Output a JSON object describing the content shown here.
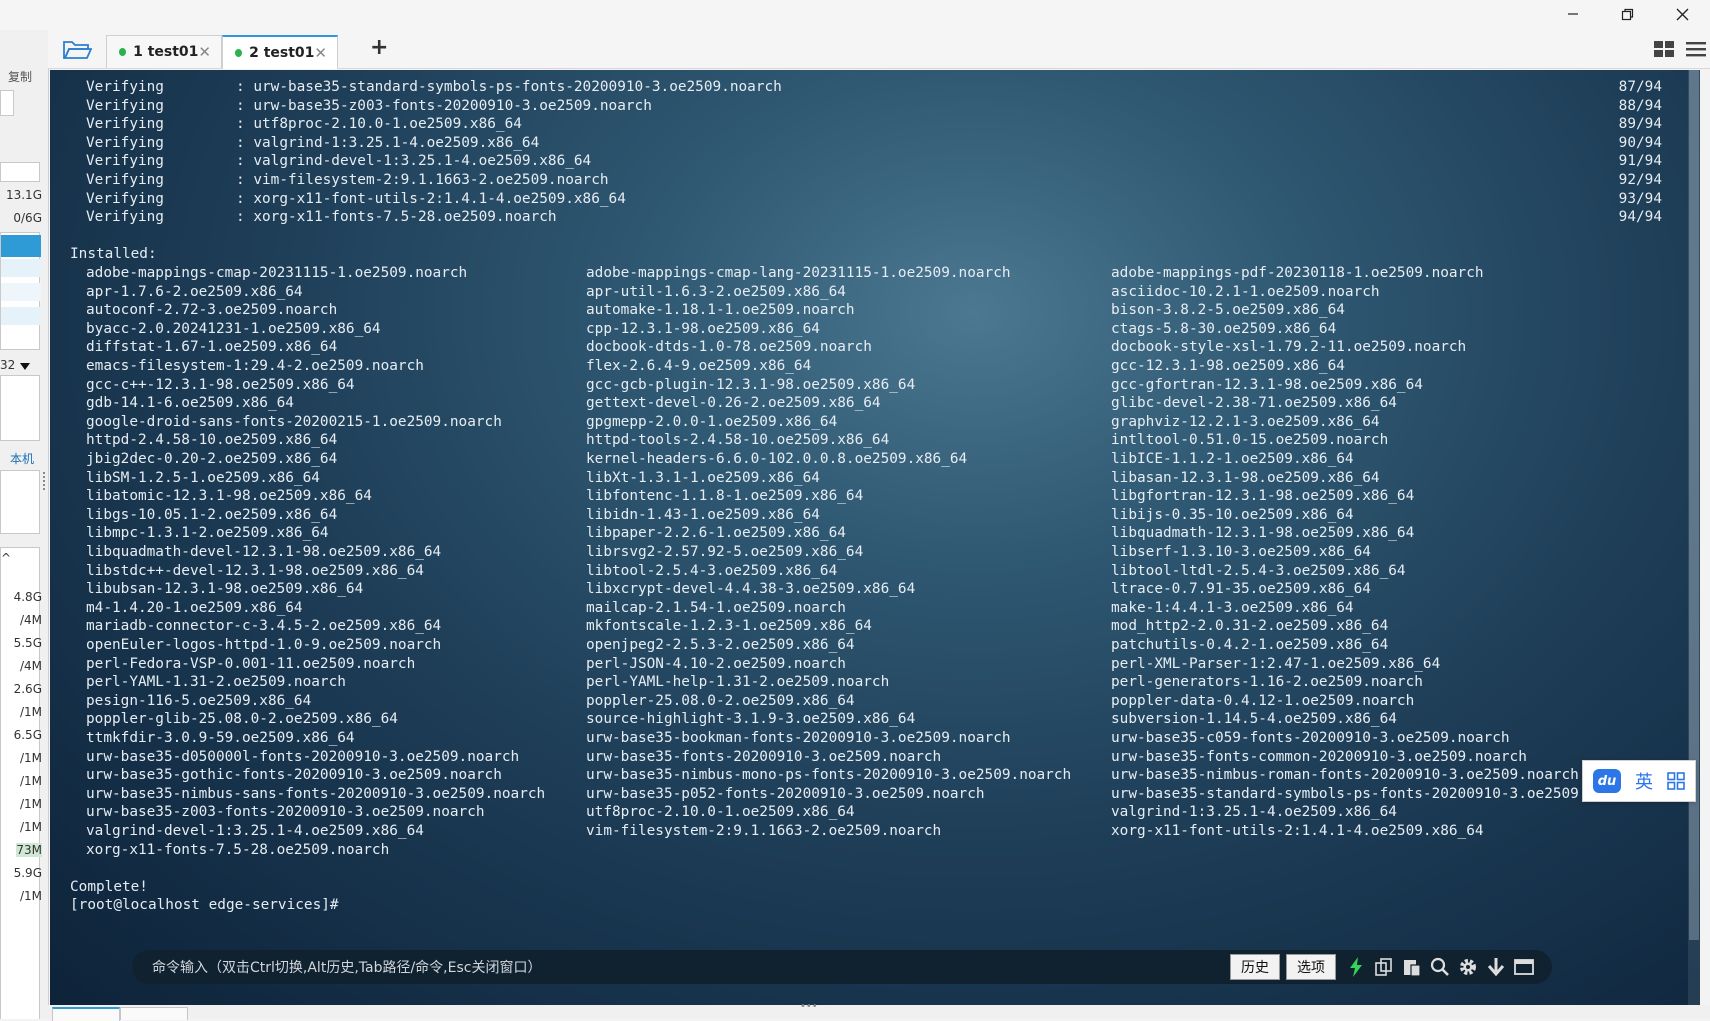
{
  "window": {
    "minimize_icon": "minimize-icon",
    "maximize_icon": "restore-icon",
    "close_icon": "close-icon"
  },
  "sidebar": {
    "copy_label": "复制",
    "local_label": "本机",
    "dropdown_value": "32",
    "disk_values": [
      "13.1G",
      "0/6G"
    ],
    "sizes": [
      "4.8G",
      "/4M",
      "5.5G",
      "/4M",
      "2.6G",
      "/1M",
      "6.5G",
      "/1M",
      "/1M",
      "/1M",
      "/1M",
      "73M",
      "5.9G",
      "/1M"
    ]
  },
  "tabs": [
    {
      "index": "1",
      "label": "test01",
      "active": false
    },
    {
      "index": "2",
      "label": "test01",
      "active": true
    }
  ],
  "tabbar": {
    "add_icon": "plus-icon",
    "folder_icon": "folder-open-icon",
    "layout_icon": "grid-layout-icon",
    "menu_icon": "hamburger-menu-icon"
  },
  "terminal": {
    "verifying": [
      {
        "label": "Verifying",
        "pkg": ": urw-base35-standard-symbols-ps-fonts-20200910-3.oe2509.noarch",
        "progress": "87/94"
      },
      {
        "label": "Verifying",
        "pkg": ": urw-base35-z003-fonts-20200910-3.oe2509.noarch",
        "progress": "88/94"
      },
      {
        "label": "Verifying",
        "pkg": ": utf8proc-2.10.0-1.oe2509.x86_64",
        "progress": "89/94"
      },
      {
        "label": "Verifying",
        "pkg": ": valgrind-1:3.25.1-4.oe2509.x86_64",
        "progress": "90/94"
      },
      {
        "label": "Verifying",
        "pkg": ": valgrind-devel-1:3.25.1-4.oe2509.x86_64",
        "progress": "91/94"
      },
      {
        "label": "Verifying",
        "pkg": ": vim-filesystem-2:9.1.1663-2.oe2509.noarch",
        "progress": "92/94"
      },
      {
        "label": "Verifying",
        "pkg": ": xorg-x11-font-utils-2:1.4.1-4.oe2509.x86_64",
        "progress": "93/94"
      },
      {
        "label": "Verifying",
        "pkg": ": xorg-x11-fonts-7.5-28.oe2509.noarch",
        "progress": "94/94"
      }
    ],
    "installed_header": "Installed:",
    "installed": [
      [
        "adobe-mappings-cmap-20231115-1.oe2509.noarch",
        "adobe-mappings-cmap-lang-20231115-1.oe2509.noarch",
        "adobe-mappings-pdf-20230118-1.oe2509.noarch"
      ],
      [
        "apr-1.7.6-2.oe2509.x86_64",
        "apr-util-1.6.3-2.oe2509.x86_64",
        "asciidoc-10.2.1-1.oe2509.noarch"
      ],
      [
        "autoconf-2.72-3.oe2509.noarch",
        "automake-1.18.1-1.oe2509.noarch",
        "bison-3.8.2-5.oe2509.x86_64"
      ],
      [
        "byacc-2.0.20241231-1.oe2509.x86_64",
        "cpp-12.3.1-98.oe2509.x86_64",
        "ctags-5.8-30.oe2509.x86_64"
      ],
      [
        "diffstat-1.67-1.oe2509.x86_64",
        "docbook-dtds-1.0-78.oe2509.noarch",
        "docbook-style-xsl-1.79.2-11.oe2509.noarch"
      ],
      [
        "emacs-filesystem-1:29.4-2.oe2509.noarch",
        "flex-2.6.4-9.oe2509.x86_64",
        "gcc-12.3.1-98.oe2509.x86_64"
      ],
      [
        "gcc-c++-12.3.1-98.oe2509.x86_64",
        "gcc-gcb-plugin-12.3.1-98.oe2509.x86_64",
        "gcc-gfortran-12.3.1-98.oe2509.x86_64"
      ],
      [
        "gdb-14.1-6.oe2509.x86_64",
        "gettext-devel-0.26-2.oe2509.x86_64",
        "glibc-devel-2.38-71.oe2509.x86_64"
      ],
      [
        "google-droid-sans-fonts-20200215-1.oe2509.noarch",
        "gpgmepp-2.0.0-1.oe2509.x86_64",
        "graphviz-12.2.1-3.oe2509.x86_64"
      ],
      [
        "httpd-2.4.58-10.oe2509.x86_64",
        "httpd-tools-2.4.58-10.oe2509.x86_64",
        "intltool-0.51.0-15.oe2509.noarch"
      ],
      [
        "jbig2dec-0.20-2.oe2509.x86_64",
        "kernel-headers-6.6.0-102.0.0.8.oe2509.x86_64",
        "libICE-1.1.2-1.oe2509.x86_64"
      ],
      [
        "libSM-1.2.5-1.oe2509.x86_64",
        "libXt-1.3.1-1.oe2509.x86_64",
        "libasan-12.3.1-98.oe2509.x86_64"
      ],
      [
        "libatomic-12.3.1-98.oe2509.x86_64",
        "libfontenc-1.1.8-1.oe2509.x86_64",
        "libgfortran-12.3.1-98.oe2509.x86_64"
      ],
      [
        "libgs-10.05.1-2.oe2509.x86_64",
        "libidn-1.43-1.oe2509.x86_64",
        "libijs-0.35-10.oe2509.x86_64"
      ],
      [
        "libmpc-1.3.1-2.oe2509.x86_64",
        "libpaper-2.2.6-1.oe2509.x86_64",
        "libquadmath-12.3.1-98.oe2509.x86_64"
      ],
      [
        "libquadmath-devel-12.3.1-98.oe2509.x86_64",
        "librsvg2-2.57.92-5.oe2509.x86_64",
        "libserf-1.3.10-3.oe2509.x86_64"
      ],
      [
        "libstdc++-devel-12.3.1-98.oe2509.x86_64",
        "libtool-2.5.4-3.oe2509.x86_64",
        "libtool-ltdl-2.5.4-3.oe2509.x86_64"
      ],
      [
        "libubsan-12.3.1-98.oe2509.x86_64",
        "libxcrypt-devel-4.4.38-3.oe2509.x86_64",
        "ltrace-0.7.91-35.oe2509.x86_64"
      ],
      [
        "m4-1.4.20-1.oe2509.x86_64",
        "mailcap-2.1.54-1.oe2509.noarch",
        "make-1:4.4.1-3.oe2509.x86_64"
      ],
      [
        "mariadb-connector-c-3.4.5-2.oe2509.x86_64",
        "mkfontscale-1.2.3-1.oe2509.x86_64",
        "mod_http2-2.0.31-2.oe2509.x86_64"
      ],
      [
        "openEuler-logos-httpd-1.0-9.oe2509.noarch",
        "openjpeg2-2.5.3-2.oe2509.x86_64",
        "patchutils-0.4.2-1.oe2509.x86_64"
      ],
      [
        "perl-Fedora-VSP-0.001-11.oe2509.noarch",
        "perl-JSON-4.10-2.oe2509.noarch",
        "perl-XML-Parser-1:2.47-1.oe2509.x86_64"
      ],
      [
        "perl-YAML-1.31-2.oe2509.noarch",
        "perl-YAML-help-1.31-2.oe2509.noarch",
        "perl-generators-1.16-2.oe2509.noarch"
      ],
      [
        "pesign-116-5.oe2509.x86_64",
        "poppler-25.08.0-2.oe2509.x86_64",
        "poppler-data-0.4.12-1.oe2509.noarch"
      ],
      [
        "poppler-glib-25.08.0-2.oe2509.x86_64",
        "source-highlight-3.1.9-3.oe2509.x86_64",
        "subversion-1.14.5-4.oe2509.x86_64"
      ],
      [
        "ttmkfdir-3.0.9-59.oe2509.x86_64",
        "urw-base35-bookman-fonts-20200910-3.oe2509.noarch",
        "urw-base35-c059-fonts-20200910-3.oe2509.noarch"
      ],
      [
        "urw-base35-d050000l-fonts-20200910-3.oe2509.noarch",
        "urw-base35-fonts-20200910-3.oe2509.noarch",
        "urw-base35-fonts-common-20200910-3.oe2509.noarch"
      ],
      [
        "urw-base35-gothic-fonts-20200910-3.oe2509.noarch",
        "urw-base35-nimbus-mono-ps-fonts-20200910-3.oe2509.noarch",
        "urw-base35-nimbus-roman-fonts-20200910-3.oe2509.noarch"
      ],
      [
        "urw-base35-nimbus-sans-fonts-20200910-3.oe2509.noarch",
        "urw-base35-p052-fonts-20200910-3.oe2509.noarch",
        "urw-base35-standard-symbols-ps-fonts-20200910-3.oe2509.noarch"
      ],
      [
        "urw-base35-z003-fonts-20200910-3.oe2509.noarch",
        "utf8proc-2.10.0-1.oe2509.x86_64",
        "valgrind-1:3.25.1-4.oe2509.x86_64"
      ],
      [
        "valgrind-devel-1:3.25.1-4.oe2509.x86_64",
        "vim-filesystem-2:9.1.1663-2.oe2509.noarch",
        "xorg-x11-font-utils-2:1.4.1-4.oe2509.x86_64"
      ],
      [
        "xorg-x11-fonts-7.5-28.oe2509.noarch",
        "",
        ""
      ]
    ],
    "complete": "Complete!",
    "prompt": "[root@localhost edge-services]#"
  },
  "command_bar": {
    "hint": "命令输入（双击Ctrl切换,Alt历史,Tab路径/命令,Esc关闭窗口）",
    "history_label": "历史",
    "options_label": "选项",
    "icons": [
      "lightning-icon",
      "copy-icon",
      "paste-icon",
      "search-icon",
      "gear-icon",
      "download-icon",
      "window-icon"
    ]
  },
  "ime": {
    "logo": "du",
    "lang": "英",
    "grid_icon": "grid-icon"
  },
  "colors": {
    "terminal_bg": "#1e3d57",
    "terminal_text": "#e6edf2",
    "tab_active_dot": "#2bb24c",
    "accent": "#2e9bd6"
  }
}
